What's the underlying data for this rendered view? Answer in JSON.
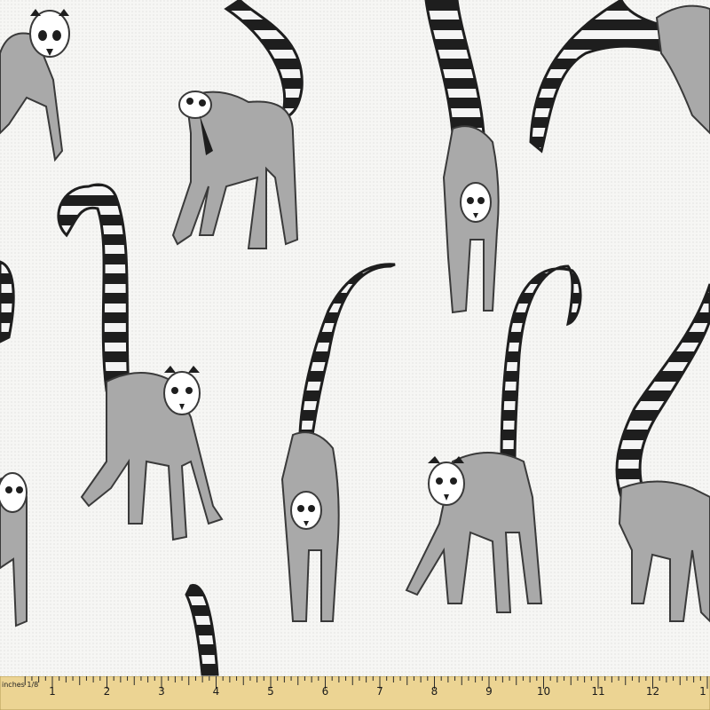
{
  "image": {
    "subject": "lemur-pattern-fabric",
    "colors": {
      "background": "#f6f6f4",
      "body": "#a9a9a9",
      "outline": "#3a3a3a",
      "stripe_dark": "#1e1e1e",
      "stripe_light": "#f4f4f4",
      "face_white": "#ffffff",
      "ruler": "#ecd493"
    }
  },
  "ruler": {
    "unit_label": "inches 1/8",
    "numbers": [
      "1",
      "2",
      "3",
      "4",
      "5",
      "6",
      "7",
      "8",
      "9",
      "10",
      "11",
      "12",
      "1"
    ]
  }
}
